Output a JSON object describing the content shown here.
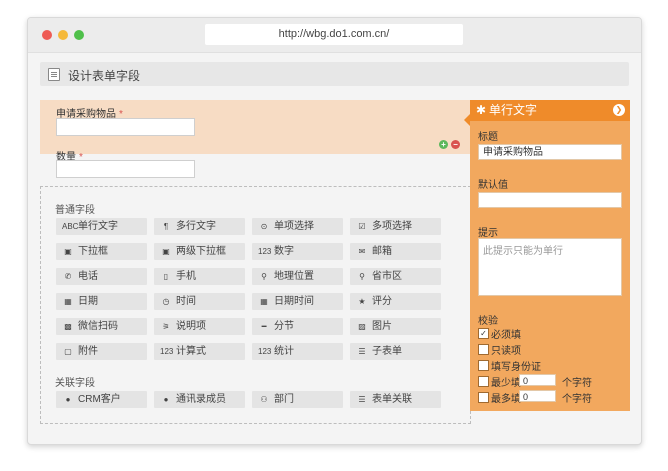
{
  "browser": {
    "url": "http://wbg.do1.com.cn/"
  },
  "header": {
    "title": "设计表单字段"
  },
  "form": {
    "field1": {
      "label": "申请采购物品",
      "required": "*"
    },
    "field2": {
      "label": "数量",
      "required": "*"
    },
    "add_icon": "+",
    "remove_icon": "−"
  },
  "palette": {
    "common_section": "普通字段",
    "common_fields": [
      {
        "label": "单行文字",
        "icon": "ABC"
      },
      {
        "label": "多行文字",
        "icon": "¶"
      },
      {
        "label": "单项选择",
        "icon": "⊙"
      },
      {
        "label": "多项选择",
        "icon": "☑"
      },
      {
        "label": "下拉框",
        "icon": "▣"
      },
      {
        "label": "两级下拉框",
        "icon": "▣"
      },
      {
        "label": "数字",
        "icon": "123"
      },
      {
        "label": "邮箱",
        "icon": "✉"
      },
      {
        "label": "电话",
        "icon": "✆"
      },
      {
        "label": "手机",
        "icon": "▯"
      },
      {
        "label": "地理位置",
        "icon": "⚲"
      },
      {
        "label": "省市区",
        "icon": "⚲"
      },
      {
        "label": "日期",
        "icon": "▦"
      },
      {
        "label": "时间",
        "icon": "◷"
      },
      {
        "label": "日期时间",
        "icon": "▦"
      },
      {
        "label": "评分",
        "icon": "★"
      },
      {
        "label": "微信扫码",
        "icon": "▩"
      },
      {
        "label": "说明项",
        "icon": "⚞"
      },
      {
        "label": "分节",
        "icon": "━"
      },
      {
        "label": "图片",
        "icon": "▨"
      },
      {
        "label": "附件",
        "icon": "▢"
      },
      {
        "label": "计算式",
        "icon": "123"
      },
      {
        "label": "统计",
        "icon": "123"
      },
      {
        "label": "子表单",
        "icon": "☰"
      }
    ],
    "related_section": "关联字段",
    "related_fields": [
      {
        "label": "CRM客户",
        "icon": "●"
      },
      {
        "label": "通讯录成员",
        "icon": "●"
      },
      {
        "label": "部门",
        "icon": "⚇"
      },
      {
        "label": "表单关联",
        "icon": "☰"
      }
    ]
  },
  "panel": {
    "title": "单行文字",
    "gear_icon": "✱",
    "collapse_icon": "❯",
    "title_label": "标题",
    "title_value": "申请采购物品",
    "default_label": "默认值",
    "default_value": "",
    "hint_label": "提示",
    "hint_value": "此提示只能为单行",
    "validation_label": "校验",
    "checks": [
      {
        "label": "必须填",
        "checked": true
      },
      {
        "label": "只读项",
        "checked": false
      },
      {
        "label": "填写身份证",
        "checked": false
      }
    ],
    "min_label": "最少填",
    "min_value": "0",
    "max_label": "最多填",
    "max_value": "0",
    "unit": "个字符"
  }
}
